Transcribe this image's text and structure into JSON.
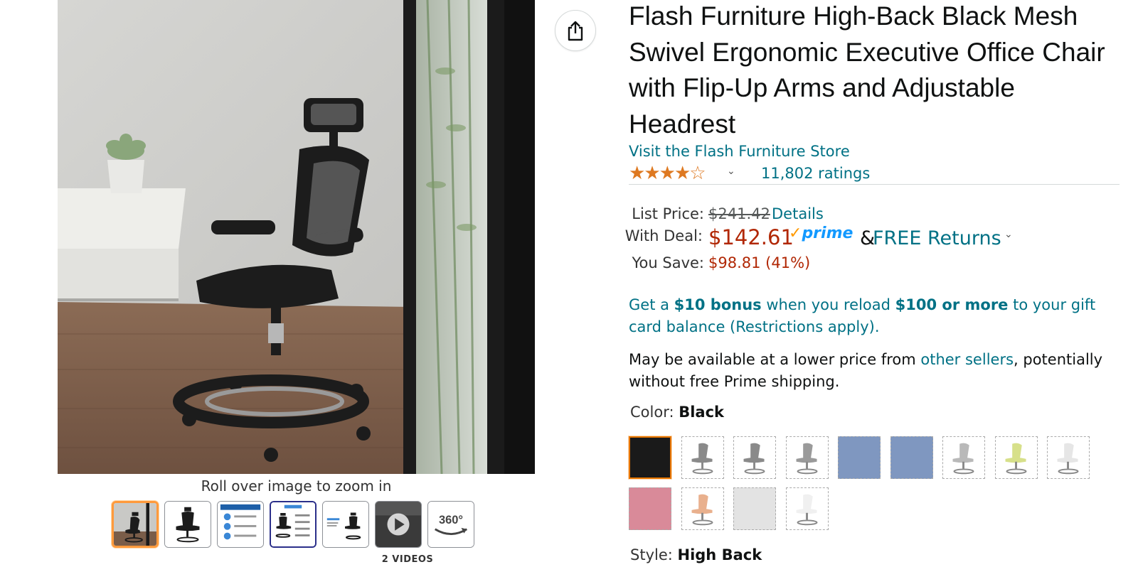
{
  "gallery": {
    "zoom_hint": "Roll over image to zoom in",
    "video_count": "2 VIDEOS",
    "thumbs": [
      {
        "name": "main-photo",
        "selected": true
      },
      {
        "name": "front-view"
      },
      {
        "name": "features-infographic"
      },
      {
        "name": "dimensions-infographic",
        "focused": true
      },
      {
        "name": "size-comparison"
      },
      {
        "name": "video",
        "is_video": true
      },
      {
        "name": "360-view",
        "label": "360°"
      }
    ]
  },
  "share": {
    "icon": "share-icon"
  },
  "product": {
    "title": "Flash Furniture High-Back Black Mesh Swivel Ergonomic Executive Office Chair with Flip-Up Arms and Adjustable Headrest",
    "store_link": "Visit the Flash Furniture Store",
    "rating_stars": 3.5,
    "ratings_count": "11,802 ratings"
  },
  "pricing": {
    "list_price_label": "List Price:",
    "list_price": "$241.42",
    "details_link": "Details",
    "deal_label": "With Deal:",
    "deal_price": "$142.61",
    "prime_label": "prime",
    "ampersand": "&",
    "free_returns": "FREE Returns",
    "save_label": "You Save:",
    "save_value": "$98.81 (41%)"
  },
  "promo": {
    "prefix": "Get a ",
    "bonus": "$10 bonus",
    "middle": " when you reload ",
    "amount": "$100 or more",
    "suffix": " to your gift card balance (Restrictions apply)."
  },
  "lower_price": {
    "prefix": "May be available at a lower price from ",
    "link": "other sellers",
    "suffix": ", potentially without free Prime shipping."
  },
  "color": {
    "label": "Color: ",
    "selected": "Black",
    "swatches": [
      {
        "name": "black",
        "color": "#1a1a1a",
        "selected": true
      },
      {
        "name": "gray-1",
        "color": "#8a8a8a",
        "chair": true
      },
      {
        "name": "gray-2",
        "color": "#8a8a8a",
        "chair": true
      },
      {
        "name": "gray-3",
        "color": "#9a9a9a",
        "chair": true
      },
      {
        "name": "blue-1",
        "color": "#7f97c0"
      },
      {
        "name": "blue-2",
        "color": "#7f97c0"
      },
      {
        "name": "light-gray",
        "color": "#b9b9b9",
        "chair": true
      },
      {
        "name": "lime",
        "color": "#d7e08a",
        "chair": true
      },
      {
        "name": "white-1",
        "color": "#e6e6e6",
        "chair": true
      },
      {
        "name": "pink",
        "color": "#d98a99"
      },
      {
        "name": "peach",
        "color": "#e9b08d",
        "chair": true
      },
      {
        "name": "light",
        "color": "#e3e3e3"
      },
      {
        "name": "white-2",
        "color": "#f0f0f0",
        "chair": true
      }
    ]
  },
  "style": {
    "label": "Style: ",
    "selected": "High Back"
  },
  "colors": {
    "link": "#007185",
    "price_red": "#b12704",
    "star_orange": "#de7921",
    "prime_blue": "#1399ff",
    "selected_orange": "#e77600"
  }
}
